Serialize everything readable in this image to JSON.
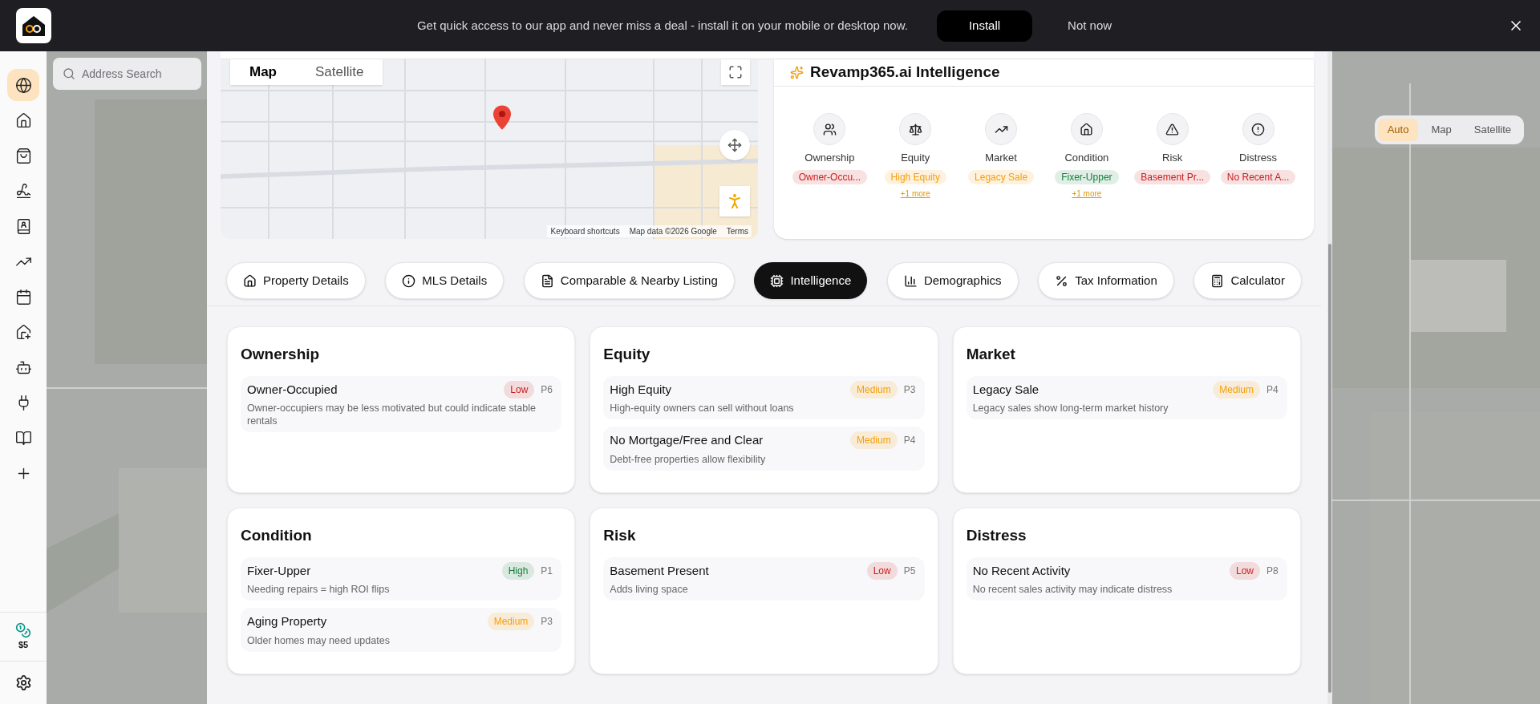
{
  "banner": {
    "message": "Get quick access to our app and never miss a deal - install it on your mobile or desktop now.",
    "install_label": "Install",
    "dismiss_label": "Not now"
  },
  "sidebar": {
    "items": [
      {
        "selected": true
      },
      {
        "selected": false
      },
      {
        "selected": false
      },
      {
        "selected": false
      },
      {
        "selected": false
      },
      {
        "selected": false
      },
      {
        "selected": false
      },
      {
        "selected": false
      },
      {
        "selected": false
      },
      {
        "selected": false
      },
      {
        "selected": false
      },
      {
        "selected": false
      }
    ],
    "credits": "$5"
  },
  "background": {
    "search_placeholder": "Address Search",
    "map_types": [
      {
        "label": "Auto",
        "selected": true
      },
      {
        "label": "Map",
        "selected": false
      },
      {
        "label": "Satellite",
        "selected": false
      }
    ]
  },
  "map": {
    "map_types": [
      {
        "label": "Map",
        "selected": true
      },
      {
        "label": "Satellite",
        "selected": false
      }
    ],
    "attribution": [
      "Keyboard shortcuts",
      "Map data ©2026 Google",
      "Terms"
    ]
  },
  "intelligence": {
    "title": "Revamp365.ai Intelligence",
    "categories": [
      {
        "label": "Ownership",
        "tag": "Owner-Occu...",
        "color": "#c81e1e"
      },
      {
        "label": "Equity",
        "tag": "High Equity",
        "color": "#f59e0b",
        "more": "+1 more"
      },
      {
        "label": "Market",
        "tag": "Legacy Sale",
        "color": "#f59e0b"
      },
      {
        "label": "Condition",
        "tag": "Fixer-Upper",
        "color": "#15803d",
        "more": "+1 more"
      },
      {
        "label": "Risk",
        "tag": "Basement Pr...",
        "color": "#c81e1e"
      },
      {
        "label": "Distress",
        "tag": "No Recent A...",
        "color": "#c81e1e"
      }
    ]
  },
  "tabs": [
    {
      "label": "Property Details",
      "selected": false
    },
    {
      "label": "MLS Details",
      "selected": false
    },
    {
      "label": "Comparable & Nearby Listing",
      "selected": false
    },
    {
      "label": "Intelligence",
      "selected": true
    },
    {
      "label": "Demographics",
      "selected": false
    },
    {
      "label": "Tax Information",
      "selected": false
    },
    {
      "label": "Calculator",
      "selected": false
    }
  ],
  "cards": [
    {
      "title": "Ownership",
      "items": [
        {
          "title": "Owner-Occupied",
          "severity": "Low",
          "color": "#c81e1e",
          "rank": "P6",
          "description": "Owner-occupiers may be less motivated but could indicate stable rentals"
        }
      ]
    },
    {
      "title": "Equity",
      "items": [
        {
          "title": "High Equity",
          "severity": "Medium",
          "color": "#f59e0b",
          "rank": "P3",
          "description": "High-equity owners can sell without loans"
        },
        {
          "title": "No Mortgage/Free and Clear",
          "severity": "Medium",
          "color": "#f59e0b",
          "rank": "P4",
          "description": "Debt-free properties allow flexibility"
        }
      ]
    },
    {
      "title": "Market",
      "items": [
        {
          "title": "Legacy Sale",
          "severity": "Medium",
          "color": "#f59e0b",
          "rank": "P4",
          "description": "Legacy sales show long-term market history"
        }
      ]
    },
    {
      "title": "Condition",
      "items": [
        {
          "title": "Fixer-Upper",
          "severity": "High",
          "color": "#15803d",
          "rank": "P1",
          "description": "Needing repairs = high ROI flips"
        },
        {
          "title": "Aging Property",
          "severity": "Medium",
          "color": "#f59e0b",
          "rank": "P3",
          "description": "Older homes may need updates"
        }
      ]
    },
    {
      "title": "Risk",
      "items": [
        {
          "title": "Basement Present",
          "severity": "Low",
          "color": "#c81e1e",
          "rank": "P5",
          "description": "Adds living space"
        }
      ]
    },
    {
      "title": "Distress",
      "items": [
        {
          "title": "No Recent Activity",
          "severity": "Low",
          "color": "#c81e1e",
          "rank": "P8",
          "description": "No recent sales activity may indicate distress"
        }
      ]
    }
  ]
}
